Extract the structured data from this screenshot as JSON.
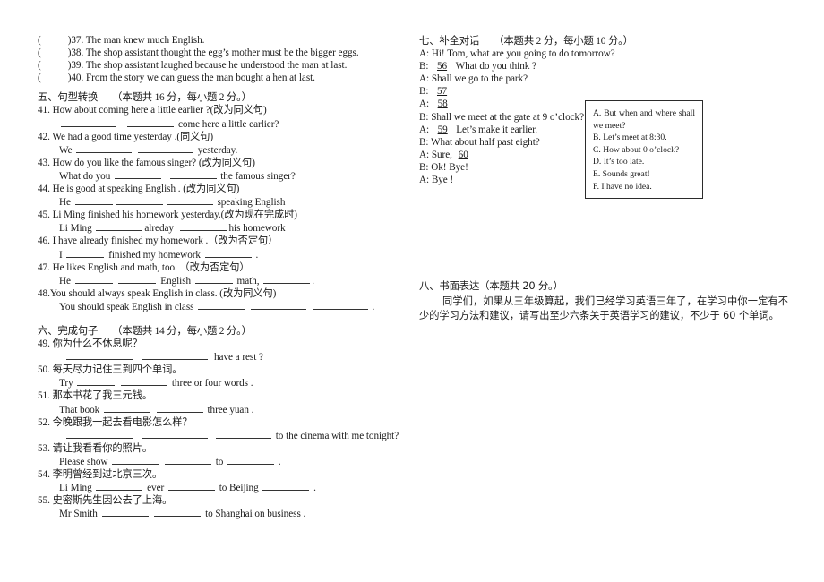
{
  "document": {
    "title": "English exam paper page — sections 5 to 8"
  },
  "left_column": {
    "truefalse_items": [
      {
        "num": "37",
        "text": "The man knew much English."
      },
      {
        "num": "38",
        "text": "The shop assistant thought the egg’s mother must be the bigger eggs."
      },
      {
        "num": "39",
        "text": "The shop assistant laughed because he understood the man at last."
      },
      {
        "num": "40",
        "text": "From the story we can guess the man bought a hen at last."
      }
    ],
    "section5": {
      "heading": "五、句型转换",
      "points": "（本题共 16 分，每小题 2 分。）",
      "items": [
        {
          "num": "41.",
          "prompt": "How about coming here a little earlier ?(改为同义句)",
          "answer_prefix": "",
          "answer_mid": "",
          "answer_suffix": "come here a little earlier?"
        },
        {
          "num": "42.",
          "prompt": "We had a good time yesterday .(同义句)",
          "answer_prefix": "We",
          "answer_suffix": "yesterday."
        },
        {
          "num": "43.",
          "prompt": "How do you like the famous singer? (改为同义句)",
          "answer_prefix": "What do you",
          "answer_suffix": "the famous singer?"
        },
        {
          "num": "44.",
          "prompt": "He is good at speaking English . (改为同义句)",
          "answer_prefix": "He",
          "answer_suffix": "speaking English"
        },
        {
          "num": "45.",
          "prompt": "Li Ming finished his homework yesterday.(改为现在完成时)",
          "answer_prefix": "Li Ming",
          "answer_mid": "alreday",
          "answer_suffix": "his homework"
        },
        {
          "num": "46.",
          "prompt": "I have already finished my homework .（改为否定句）",
          "answer_prefix": "I",
          "answer_mid": "finished my homework",
          "answer_suffix": "."
        },
        {
          "num": "47.",
          "prompt": "He likes English and math, too. （改为否定句）",
          "answer_prefix": "He",
          "answer_mid": "English",
          "answer_mid2": "math,",
          "answer_suffix": "."
        },
        {
          "num": "48.",
          "prompt": "You should always speak English in class. (改为同义句)",
          "answer_prefix": "You should   speak English in class",
          "answer_suffix": "."
        }
      ]
    },
    "section6": {
      "heading": "六、完成句子",
      "points": "（本题共 14 分，每小题 2 分。）",
      "items": [
        {
          "num": "49.",
          "prompt": "你为什么不休息呢？",
          "answer_prefix": "",
          "answer_suffix": "have a rest ?"
        },
        {
          "num": "50.",
          "prompt": "每天尽力记住三到四个单词。",
          "answer_prefix": "Try",
          "answer_suffix": "three or four words ."
        },
        {
          "num": "51.",
          "prompt": "那本书花了我三元钱。",
          "answer_prefix": "That book",
          "answer_suffix": "three yuan ."
        },
        {
          "num": "52.",
          "prompt": "今晚跟我一起去看电影怎么样？",
          "answer_prefix": "",
          "answer_suffix": "to the cinema with me tonight?"
        },
        {
          "num": "53.",
          "prompt": "请让我看看你的照片。",
          "answer_prefix": "Please show",
          "answer_mid": "to",
          "answer_suffix": "."
        },
        {
          "num": "54.",
          "prompt": "李明曾经到过北京三次。",
          "answer_prefix": "Li Ming",
          "answer_mid": "ever",
          "answer_mid2": "to Beijing",
          "answer_suffix": "."
        },
        {
          "num": "55.",
          "prompt": "史密斯先生因公去了上海。",
          "answer_prefix": "Mr Smith",
          "answer_suffix": "to Shanghai on business ."
        }
      ]
    }
  },
  "right_column": {
    "section7": {
      "heading": "七、补全对话",
      "points": "（本题共 2 分，每小题 10 分。）",
      "dialogue": [
        {
          "speaker": "A:",
          "text": "Hi! Tom, what are you going to do tomorrow?",
          "blank": ""
        },
        {
          "speaker": "B:",
          "blank": "56",
          "text": "What do you think ?"
        },
        {
          "speaker": "A:",
          "text": "Shall we go to the park?",
          "blank": ""
        },
        {
          "speaker": "B:",
          "blank": "57",
          "text": ""
        },
        {
          "speaker": "A:",
          "blank": "58",
          "text": ""
        },
        {
          "speaker": "B:",
          "text": "Shall we meet at the gate at 9 o’clock?",
          "blank": ""
        },
        {
          "speaker": "A:",
          "blank": "59",
          "text": "Let’s make it earlier."
        },
        {
          "speaker": "B:",
          "text": "What about half past eight?",
          "blank": ""
        },
        {
          "speaker": "A:",
          "text": "Sure,",
          "blank": "60",
          "blank_after": true
        },
        {
          "speaker": "B:",
          "text": "Ok! Bye!",
          "blank": ""
        },
        {
          "speaker": "A:",
          "text": "Bye !",
          "blank": ""
        }
      ],
      "options_box": [
        "A. But when and where shall",
        "we meet?",
        "B. Let’s meet at 8:30.",
        "C. How about 0 o’clock?",
        "D. It’s too late.",
        "E. Sounds great!",
        "F. I have no idea."
      ]
    },
    "section8": {
      "heading": "八、书面表达（本题共 20 分。）",
      "body": "同学们，如果从三年级算起，我们已经学习英语三年了，在学习中你一定有不少的学习方法和建议，请写出至少六条关于英语学习的建议，不少于 60 个单词。"
    }
  }
}
